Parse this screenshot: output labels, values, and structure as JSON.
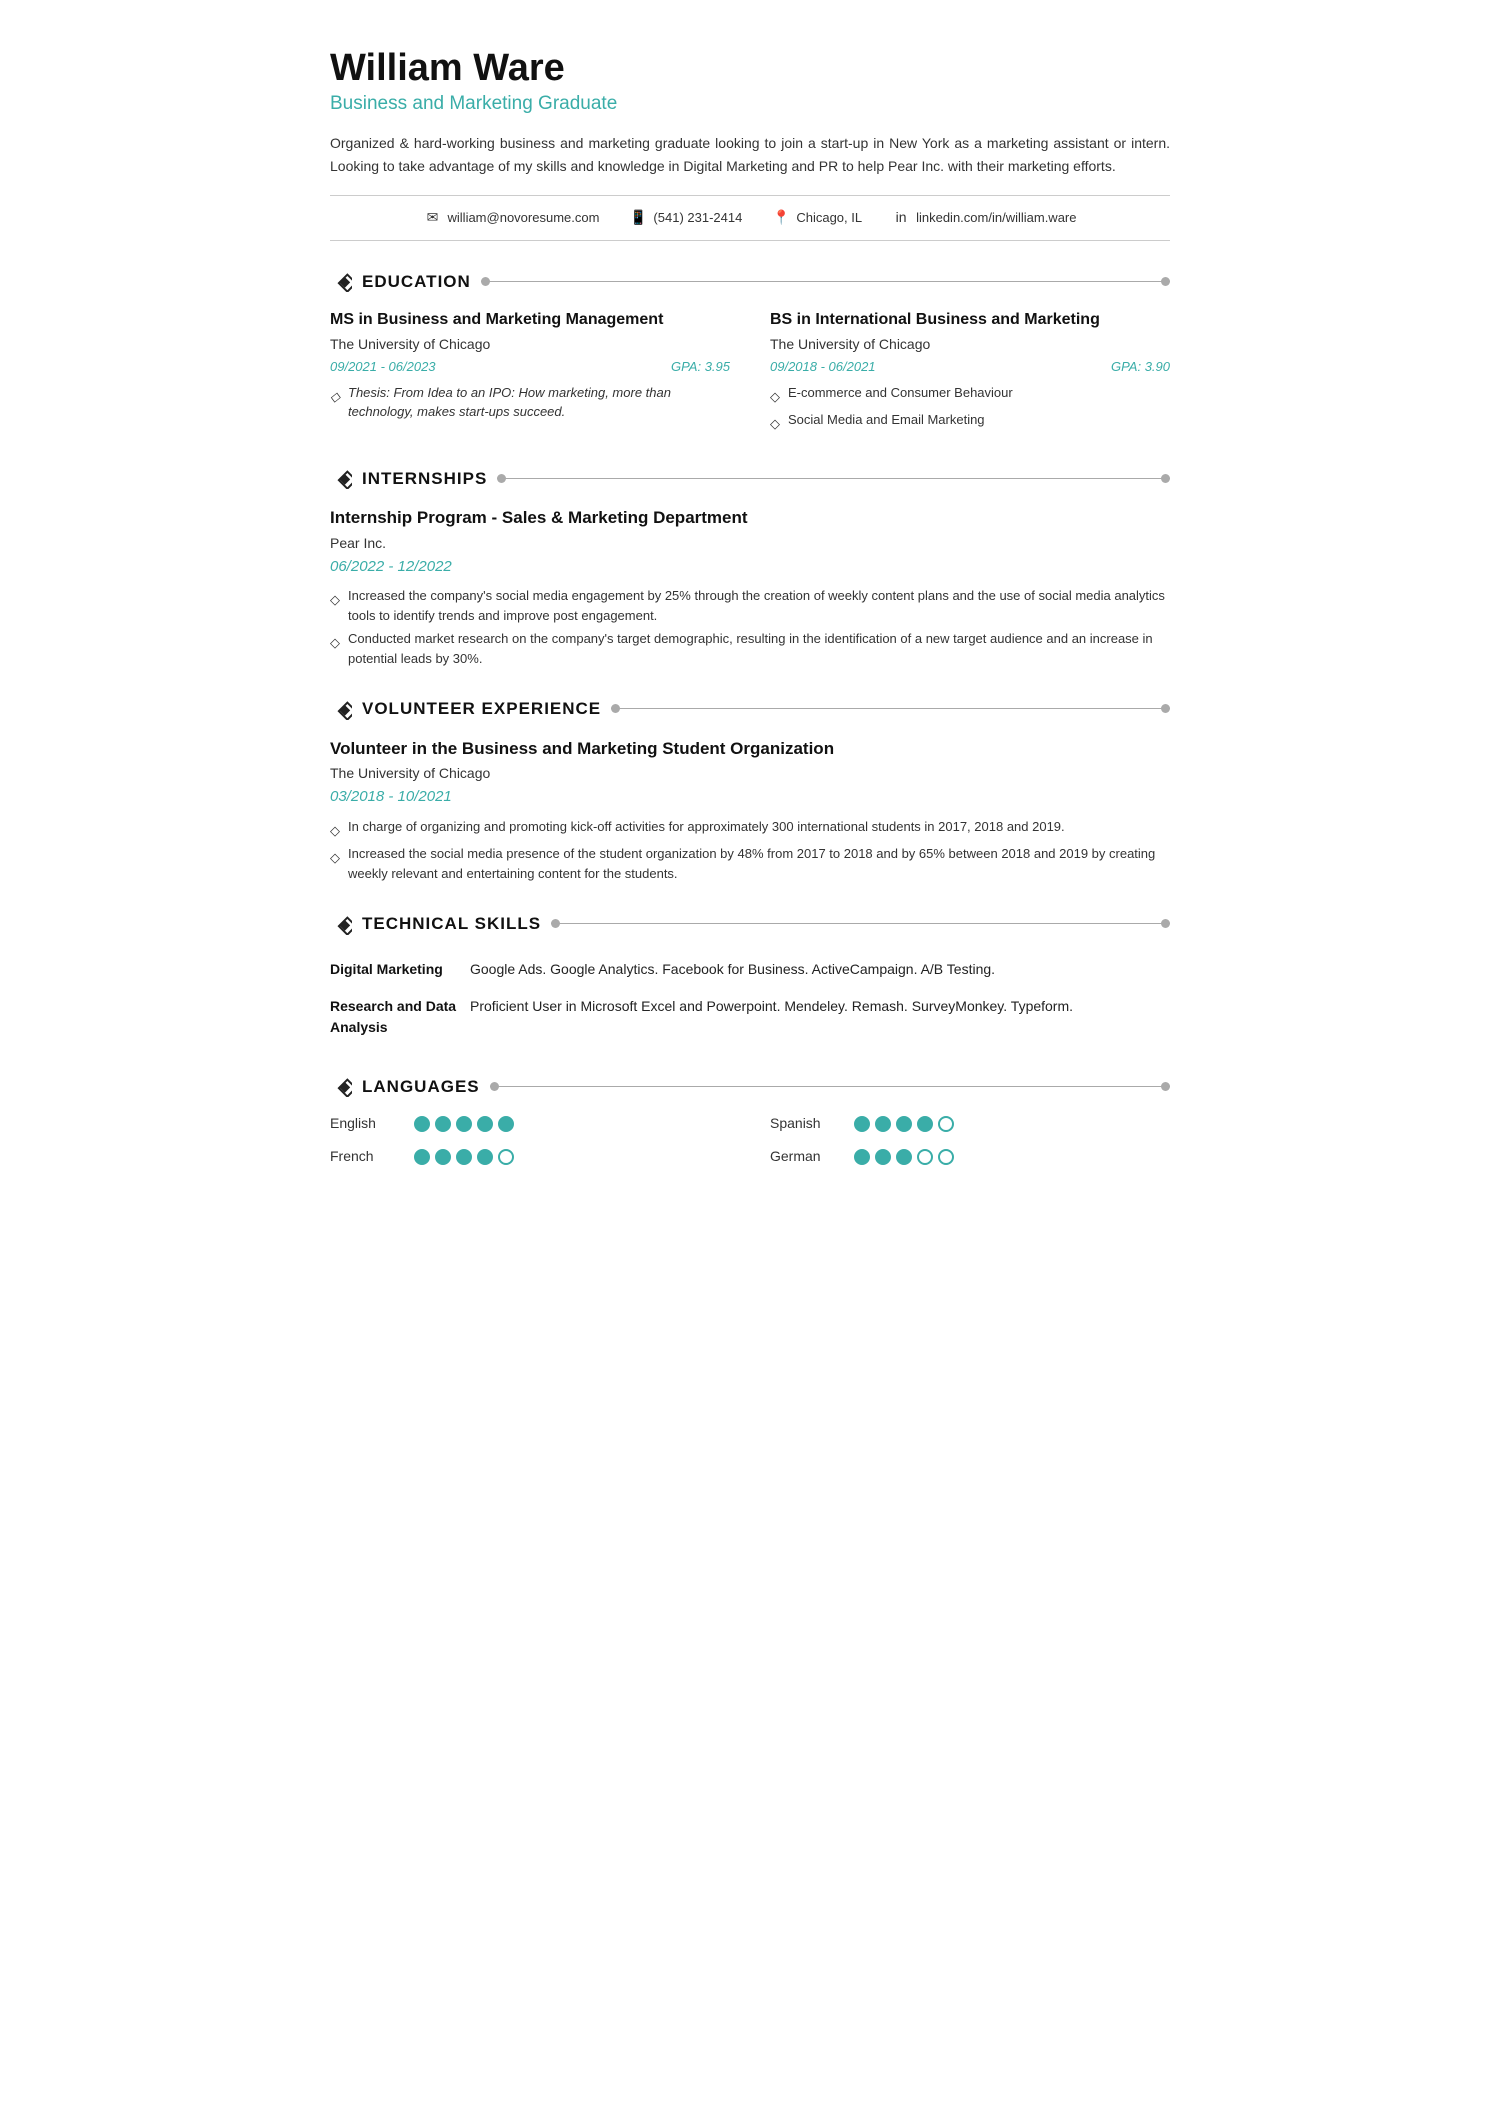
{
  "header": {
    "name": "William Ware",
    "subtitle": "Business and Marketing Graduate",
    "summary": "Organized & hard-working business and marketing graduate looking to join a start-up in New York as a marketing assistant or intern. Looking to take advantage of my skills and knowledge in Digital Marketing and PR to help Pear Inc. with their marketing efforts."
  },
  "contact": {
    "email": "william@novoresume.com",
    "phone": "(541) 231-2414",
    "location": "Chicago, IL",
    "linkedin": "linkedin.com/in/william.ware"
  },
  "sections": {
    "education": {
      "title": "EDUCATION",
      "entries": [
        {
          "degree": "MS in Business and Marketing Management",
          "institution": "The University of Chicago",
          "dates": "09/2021 - 06/2023",
          "gpa": "GPA: 3.95",
          "bullets": [
            "Thesis: From Idea to an IPO: How marketing, more than technology, makes start-ups succeed."
          ],
          "italic_bullets": true
        },
        {
          "degree": "BS in International Business and Marketing",
          "institution": "The University of Chicago",
          "dates": "09/2018 - 06/2021",
          "gpa": "GPA: 3.90",
          "bullets": [
            "E-commerce and Consumer Behaviour",
            "Social Media and Email Marketing"
          ],
          "italic_bullets": false
        }
      ]
    },
    "internships": {
      "title": "INTERNSHIPS",
      "entries": [
        {
          "title": "Internship Program - Sales & Marketing Department",
          "company": "Pear Inc.",
          "dates": "06/2022 - 12/2022",
          "bullets": [
            "Increased the company's social media engagement by 25% through the creation of weekly content plans and the use of social media analytics tools to identify trends and improve post engagement.",
            "Conducted market research on the company's target demographic, resulting in the identification of a new target audience and an increase in potential leads by 30%."
          ]
        }
      ]
    },
    "volunteer": {
      "title": "VOLUNTEER EXPERIENCE",
      "entries": [
        {
          "title": "Volunteer in the Business and Marketing Student Organization",
          "company": "The University of Chicago",
          "dates": "03/2018 - 10/2021",
          "bullets": [
            "In charge of organizing and promoting kick-off activities for approximately 300 international students in 2017, 2018 and 2019.",
            "Increased the social media presence of the student organization by 48% from 2017 to 2018 and by 65% between 2018 and 2019 by creating weekly relevant and entertaining content for the students."
          ]
        }
      ]
    },
    "skills": {
      "title": "TECHNICAL SKILLS",
      "rows": [
        {
          "label": "Digital Marketing",
          "value": "Google Ads. Google Analytics. Facebook for Business. ActiveCampaign. A/B Testing."
        },
        {
          "label": "Research and Data Analysis",
          "value": "Proficient User in Microsoft Excel and Powerpoint. Mendeley. Remash. SurveyMonkey. Typeform."
        }
      ]
    },
    "languages": {
      "title": "LANGUAGES",
      "entries": [
        {
          "name": "English",
          "filled": 5,
          "total": 5
        },
        {
          "name": "Spanish",
          "filled": 4,
          "total": 5
        },
        {
          "name": "French",
          "filled": 4,
          "total": 5
        },
        {
          "name": "German",
          "filled": 3,
          "total": 5
        }
      ]
    }
  }
}
